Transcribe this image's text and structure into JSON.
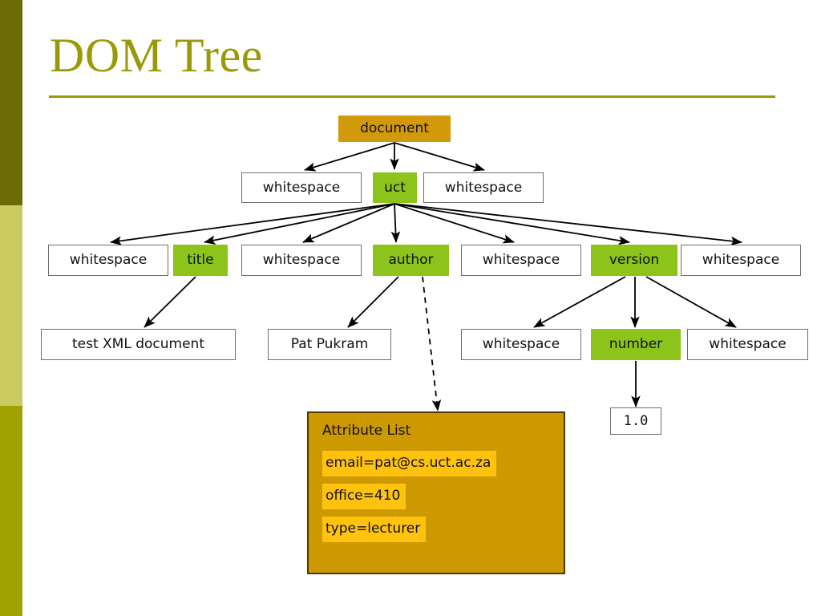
{
  "slide": {
    "title": "DOM Tree",
    "background": "#ffffff",
    "accent_color": "#9A9A08"
  },
  "sidebar": {
    "segments": [
      {
        "name": "top",
        "color": "#6B6A04"
      },
      {
        "name": "middle",
        "color": "#CBCC60"
      },
      {
        "name": "bottom",
        "color": "#A1A102"
      }
    ]
  },
  "palette": {
    "element_node": "#8CC41B",
    "document_node": "#D29A0A",
    "attribute_panel": "#CC9900",
    "attribute_item": "#FFC20E",
    "text_node_border": "#6d6d6d"
  },
  "chart_data": {
    "type": "diagram",
    "title": "DOM Tree",
    "nodes": [
      {
        "id": "document",
        "label": "document",
        "kind": "document",
        "row": 0
      },
      {
        "id": "ws1",
        "label": "whitespace",
        "kind": "text",
        "row": 1
      },
      {
        "id": "uct",
        "label": "uct",
        "kind": "element",
        "row": 1
      },
      {
        "id": "ws2",
        "label": "whitespace",
        "kind": "text",
        "row": 1
      },
      {
        "id": "ws3",
        "label": "whitespace",
        "kind": "text",
        "row": 2
      },
      {
        "id": "title",
        "label": "title",
        "kind": "element",
        "row": 2
      },
      {
        "id": "ws4",
        "label": "whitespace",
        "kind": "text",
        "row": 2
      },
      {
        "id": "author",
        "label": "author",
        "kind": "element",
        "row": 2
      },
      {
        "id": "ws5",
        "label": "whitespace",
        "kind": "text",
        "row": 2
      },
      {
        "id": "version",
        "label": "version",
        "kind": "element",
        "row": 2
      },
      {
        "id": "ws6",
        "label": "whitespace",
        "kind": "text",
        "row": 2
      },
      {
        "id": "testxml",
        "label": "test XML document",
        "kind": "text",
        "row": 3
      },
      {
        "id": "patpukram",
        "label": "Pat Pukram",
        "kind": "text",
        "row": 3
      },
      {
        "id": "ws7",
        "label": "whitespace",
        "kind": "text",
        "row": 3
      },
      {
        "id": "number",
        "label": "number",
        "kind": "element",
        "row": 3
      },
      {
        "id": "ws8",
        "label": "whitespace",
        "kind": "text",
        "row": 3
      },
      {
        "id": "onepointzero",
        "label": "1.0",
        "kind": "text",
        "row": 4
      }
    ],
    "edges": [
      {
        "from": "document",
        "to": "ws1",
        "style": "solid"
      },
      {
        "from": "document",
        "to": "uct",
        "style": "solid"
      },
      {
        "from": "document",
        "to": "ws2",
        "style": "solid"
      },
      {
        "from": "uct",
        "to": "ws3",
        "style": "solid"
      },
      {
        "from": "uct",
        "to": "title",
        "style": "solid"
      },
      {
        "from": "uct",
        "to": "ws4",
        "style": "solid"
      },
      {
        "from": "uct",
        "to": "author",
        "style": "solid"
      },
      {
        "from": "uct",
        "to": "ws5",
        "style": "solid"
      },
      {
        "from": "uct",
        "to": "version",
        "style": "solid"
      },
      {
        "from": "uct",
        "to": "ws6",
        "style": "solid"
      },
      {
        "from": "title",
        "to": "testxml",
        "style": "solid"
      },
      {
        "from": "author",
        "to": "patpukram",
        "style": "solid"
      },
      {
        "from": "author",
        "to": "attribute_list",
        "style": "dashed"
      },
      {
        "from": "version",
        "to": "ws7",
        "style": "solid"
      },
      {
        "from": "version",
        "to": "number",
        "style": "solid"
      },
      {
        "from": "version",
        "to": "ws8",
        "style": "solid"
      },
      {
        "from": "number",
        "to": "onepointzero",
        "style": "solid"
      }
    ]
  },
  "tree": {
    "row0": {
      "document": "document"
    },
    "row1": {
      "ws_left": "whitespace",
      "uct": "uct",
      "ws_right": "whitespace"
    },
    "row2": {
      "ws1": "whitespace",
      "title": "title",
      "ws2": "whitespace",
      "author": "author",
      "ws3": "whitespace",
      "version": "version",
      "ws4": "whitespace"
    },
    "row3": {
      "test_xml": "test XML document",
      "pat_pukram": "Pat Pukram",
      "ws1": "whitespace",
      "number": "number",
      "ws2": "whitespace"
    },
    "row4": {
      "version_value": "1.0"
    }
  },
  "attribute_list": {
    "heading": "Attribute List",
    "items": [
      "email=pat@cs.uct.ac.za",
      "office=410",
      "type=lecturer"
    ]
  }
}
